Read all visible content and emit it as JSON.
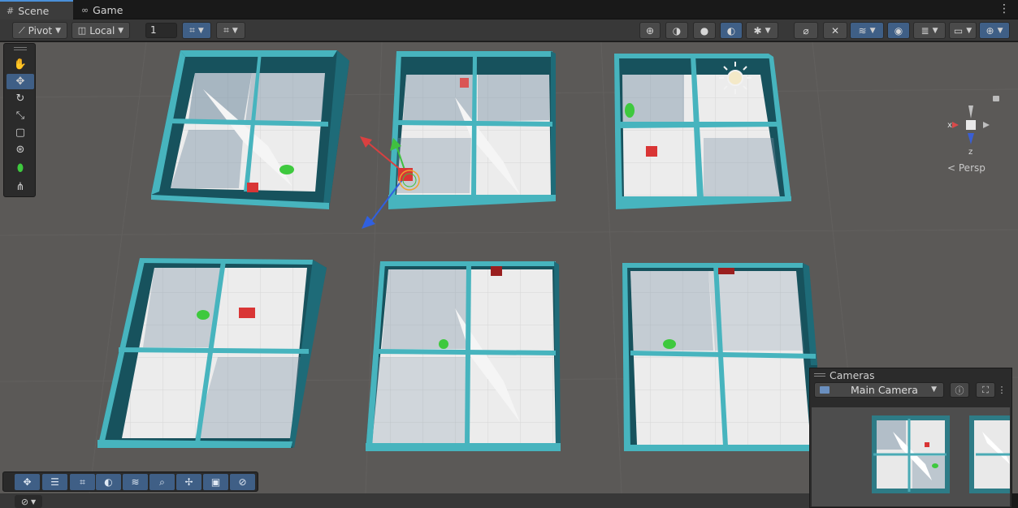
{
  "tabs": [
    {
      "label": "Scene",
      "icon": "grid-icon",
      "active": true
    },
    {
      "label": "Game",
      "icon": "gamepad-icon",
      "active": false
    }
  ],
  "toolbar": {
    "pivot_label": "Pivot",
    "space_label": "Local",
    "grid_increment": "1"
  },
  "tools": [
    "hand-tool",
    "move-tool",
    "rotate-tool",
    "scale-tool",
    "rect-tool",
    "transform-tool",
    "custom-tool",
    "ai-navigation-tool"
  ],
  "gizmo": {
    "x_label": "x",
    "z_label": "z",
    "projection_label": "Persp"
  },
  "cameras_overlay": {
    "title": "Cameras",
    "selected_camera": "Main Camera"
  },
  "colors": {
    "wall": "#1f6a78",
    "wall_top": "#46b3bd",
    "floor": "#eeeeee",
    "ground": "#5a5856",
    "agent": "#3ec93e",
    "target": "#d93535",
    "accent": "#3f5f86"
  }
}
